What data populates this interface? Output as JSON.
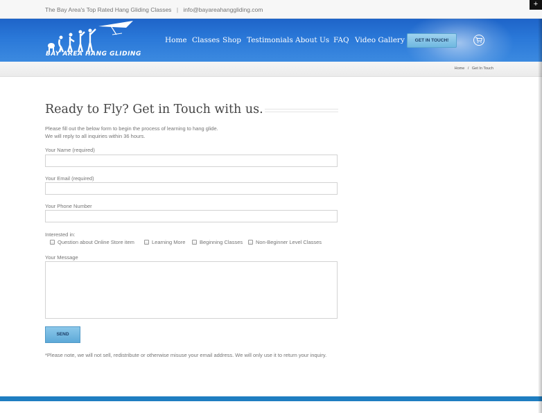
{
  "topbar": {
    "tagline": "The Bay Area's Top Rated Hang Gliding Classes",
    "separator": "|",
    "email": "info@bayareahanggliding.com",
    "corner_icon": "+"
  },
  "header": {
    "logo_text": "BAY AREA HANG GLIDING",
    "nav": [
      "Home",
      "Classes",
      "Shop",
      "Testimonials",
      "About Us",
      "FAQ",
      "Video Gallery"
    ],
    "cta_label": "GET IN TOUCH!",
    "cart_icon": "cart-icon",
    "brand_color": "#2a78d8"
  },
  "breadcrumbs": {
    "items": [
      "Home",
      "Get In Touch"
    ],
    "separator": "/"
  },
  "content": {
    "heading": "Ready to Fly? Get in Touch with us.",
    "intro_line1": "Please fill out the below form to begin the process of learning to hang glide.",
    "intro_line2": "We will reply to all inquiries within 36 hours.",
    "form": {
      "name_label": "Your Name (required)",
      "name_value": "",
      "email_label": "Your Email (required)",
      "email_value": "",
      "phone_label": "Your Phone Number",
      "phone_value": "",
      "interest_label": "Interested in:",
      "interests": [
        "Question about Online Store item",
        "Learning More",
        "Beginning Classes",
        "Non-Beginner Level Classes"
      ],
      "message_label": "Your Message",
      "message_value": "",
      "send_label": "SEND"
    },
    "note": "*Please note, we will not sell, redistribute or otherwise misuse your email address. We will only use it to return your inquiry."
  },
  "footer": {
    "band_color": "#1f7ec1"
  }
}
